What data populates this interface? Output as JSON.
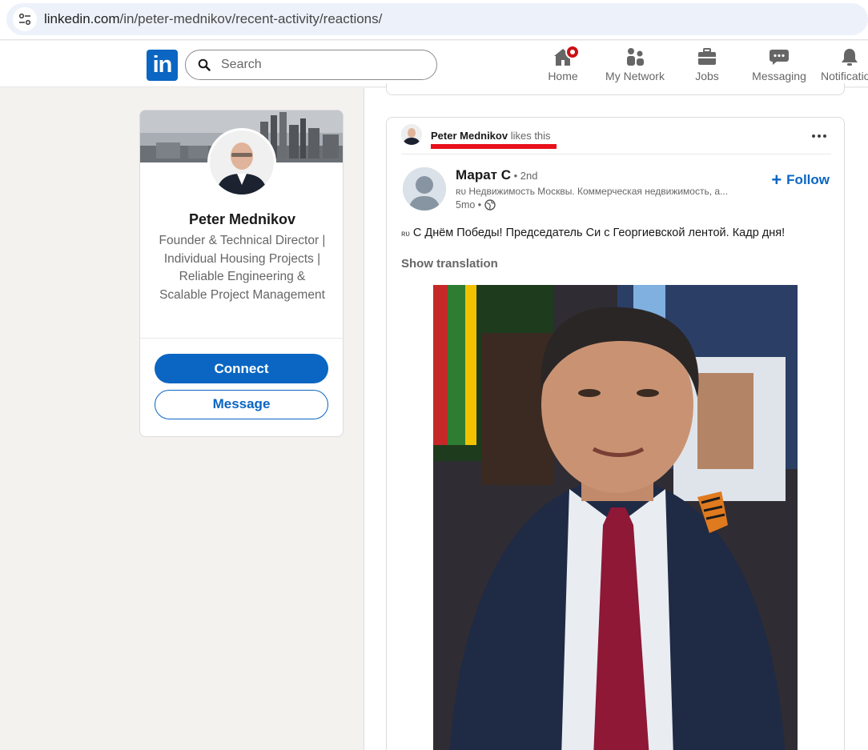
{
  "browser": {
    "url_host": "linkedin.com",
    "url_path": "/in/peter-mednikov/recent-activity/reactions/"
  },
  "nav": {
    "logo_text": "in",
    "search_placeholder": "Search",
    "items": [
      {
        "label": "Home",
        "icon": "home-icon"
      },
      {
        "label": "My Network",
        "icon": "people-icon"
      },
      {
        "label": "Jobs",
        "icon": "briefcase-icon"
      },
      {
        "label": "Messaging",
        "icon": "message-icon"
      },
      {
        "label": "Notifications",
        "icon": "bell-icon"
      }
    ]
  },
  "profile": {
    "name": "Peter Mednikov",
    "headline": "Founder & Technical Director | Individual Housing Projects | Reliable Engineering & Scalable Project Management",
    "connect_label": "Connect",
    "message_label": "Message"
  },
  "post": {
    "reaction": {
      "name": "Peter Mednikov",
      "action": " likes this"
    },
    "author": {
      "name": "Марат С",
      "degree": " • 2nd",
      "description": "ʀᴜ Недвижимость Москвы. Коммерческая недвижимость, а...",
      "time": "5mo •"
    },
    "follow_label": "Follow",
    "lang_tag": "ʀᴜ",
    "text": "С Днём Победы! Председатель Си с Георгиевской лентой. Кадр дня!",
    "show_translation": "Show translation"
  },
  "colors": {
    "brand": "#0a66c2",
    "highlight_underline": "#e8101a",
    "notification_badge": "#cc1016"
  }
}
